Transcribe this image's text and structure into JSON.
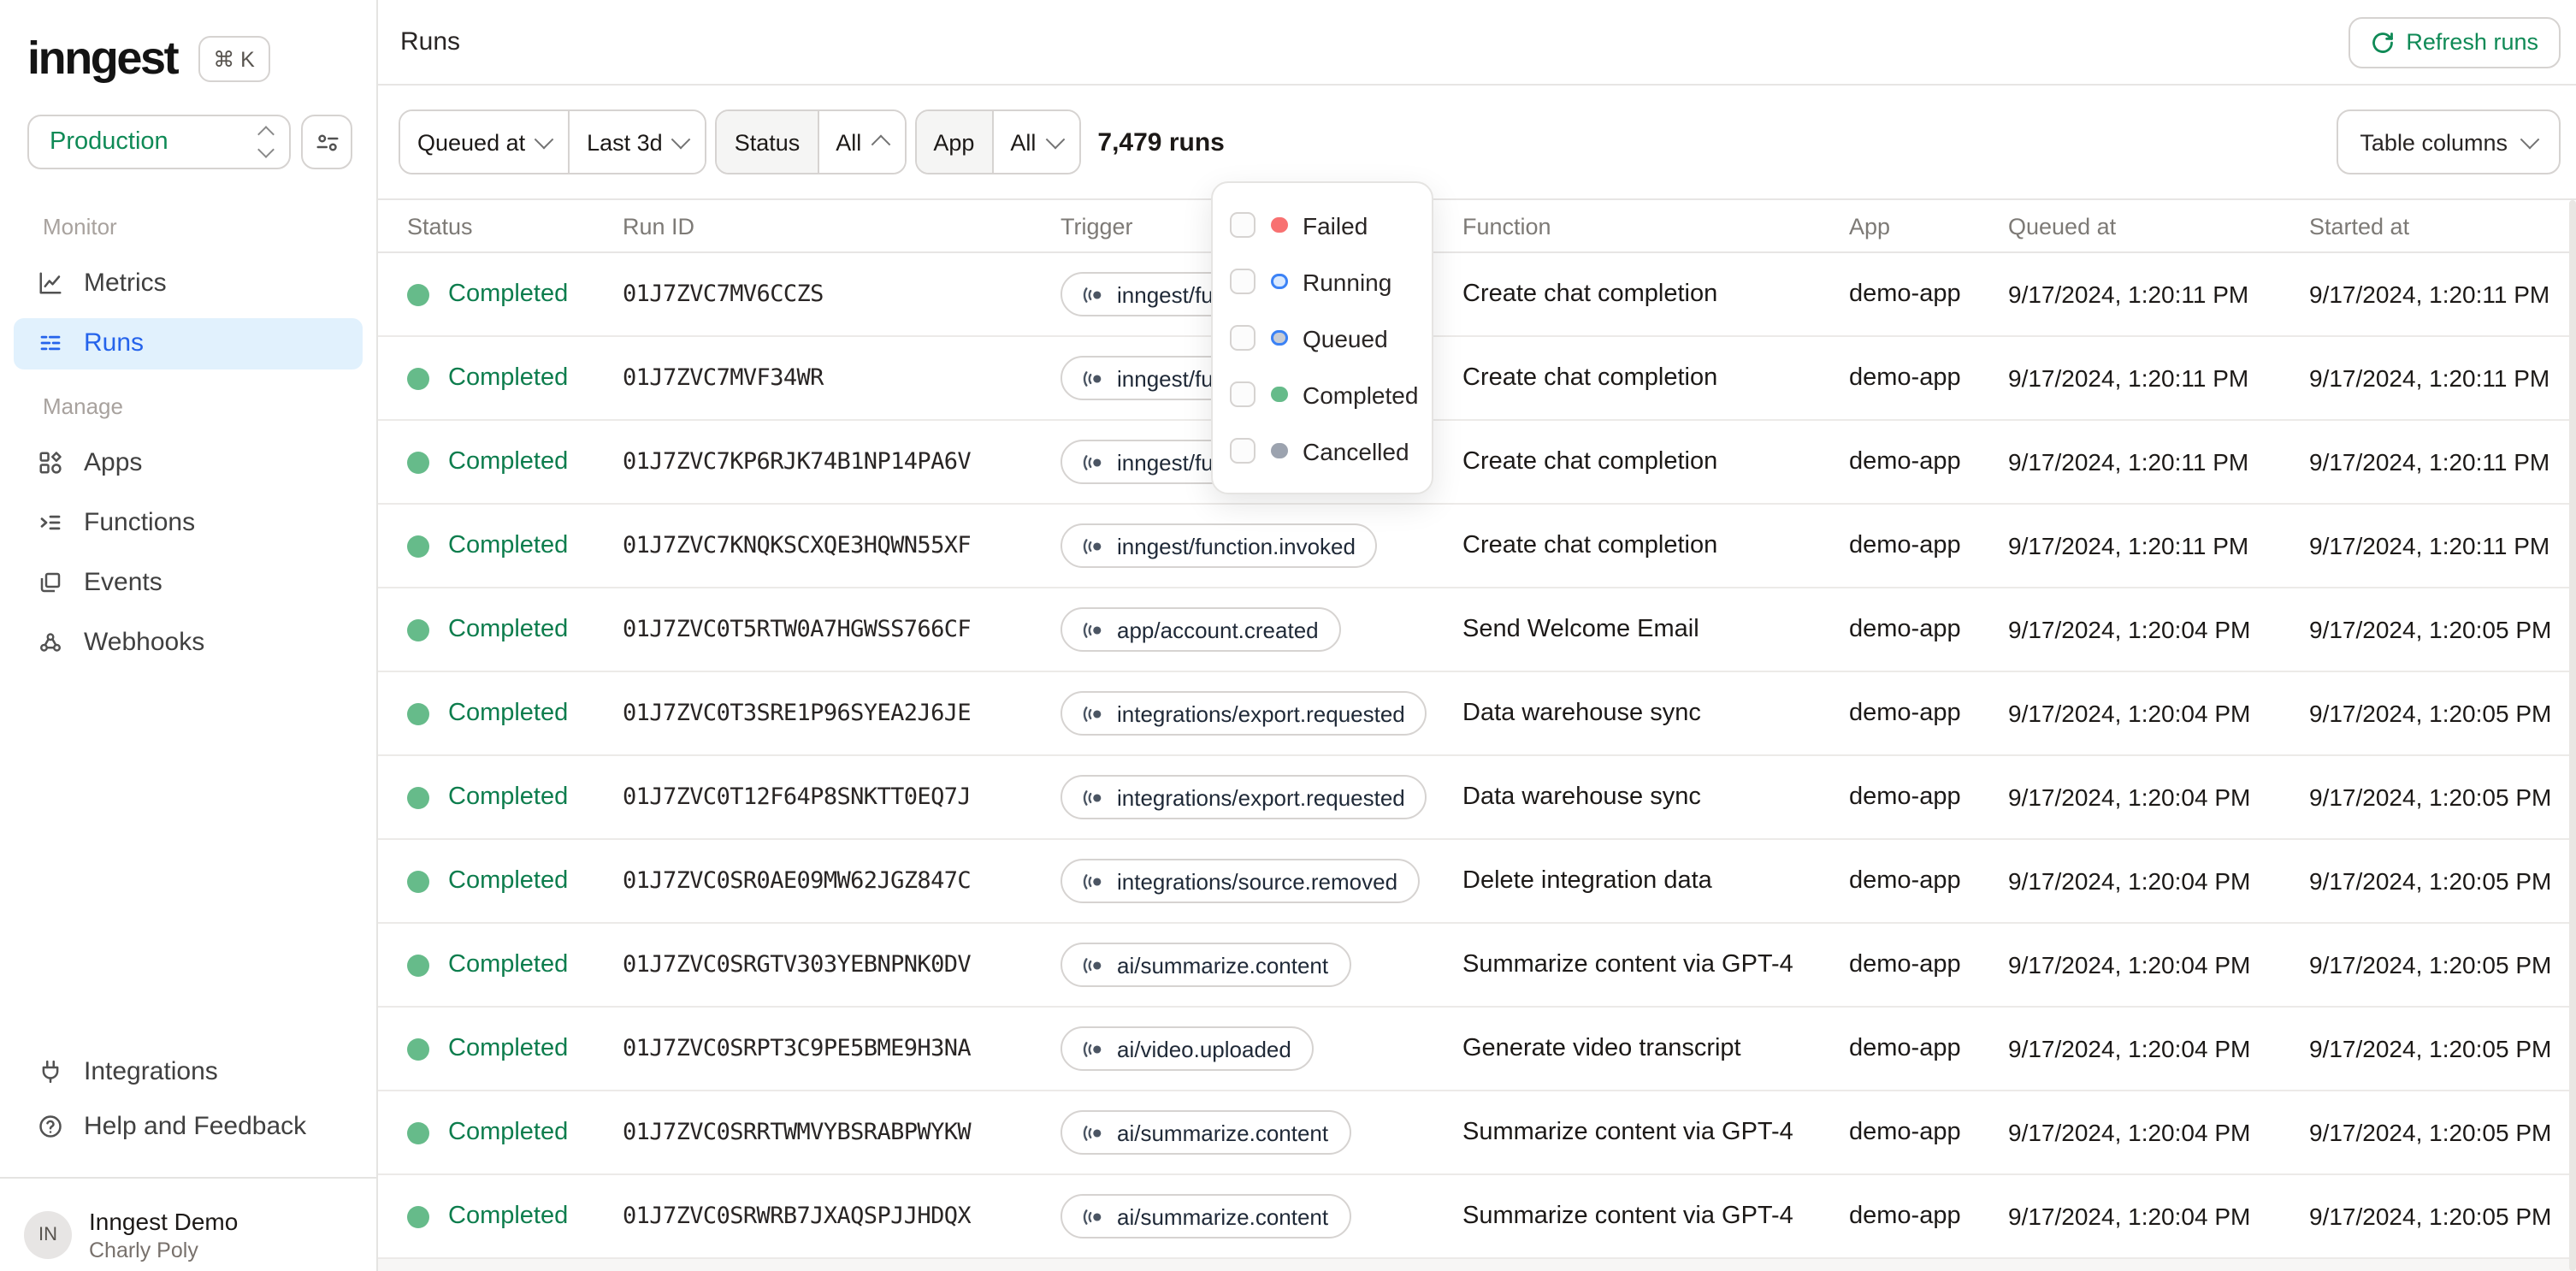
{
  "sidebar": {
    "logo": "inngest",
    "kbd_shortcut": "⌘ K",
    "environment": "Production",
    "sections": [
      {
        "label": "Monitor",
        "items": [
          {
            "label": "Metrics"
          },
          {
            "label": "Runs"
          }
        ]
      },
      {
        "label": "Manage",
        "items": [
          {
            "label": "Apps"
          },
          {
            "label": "Functions"
          },
          {
            "label": "Events"
          },
          {
            "label": "Webhooks"
          }
        ]
      }
    ],
    "footer_items": [
      {
        "label": "Integrations"
      },
      {
        "label": "Help and Feedback"
      }
    ],
    "user": {
      "initials": "IN",
      "org": "Inngest Demo",
      "name": "Charly Poly"
    }
  },
  "topbar": {
    "title": "Runs",
    "refresh_label": "Refresh runs"
  },
  "filters": {
    "queued_at_label": "Queued at",
    "time_range": "Last 3d",
    "status_label": "Status",
    "status_value": "All",
    "app_label": "App",
    "app_value": "All",
    "runs_count": "7,479 runs",
    "table_columns_label": "Table columns"
  },
  "status_dropdown": {
    "options": [
      {
        "label": "Failed",
        "fill": "#f87171",
        "ring": "#f87171"
      },
      {
        "label": "Running",
        "fill": "#dbeafe",
        "ring": "#3b82f6"
      },
      {
        "label": "Queued",
        "fill": "#c9cdd4",
        "ring": "#3b82f6"
      },
      {
        "label": "Completed",
        "fill": "#66bb8a",
        "ring": "#66bb8a"
      },
      {
        "label": "Cancelled",
        "fill": "#9ca3af",
        "ring": "#9ca3af"
      }
    ]
  },
  "table": {
    "columns": [
      "Status",
      "Run ID",
      "Trigger",
      "Function",
      "App",
      "Queued at",
      "Started at"
    ],
    "status_dot_color": "#66bb8a",
    "status_text_color": "#0d7d4d",
    "rows": [
      {
        "status": "Completed",
        "run_id": "01J7ZVC7MV6CCZS",
        "trigger": "inngest/function.invoked",
        "function": "Create chat completion",
        "app": "demo-app",
        "queued_at": "9/17/2024, 1:20:11 PM",
        "started_at": "9/17/2024, 1:20:11 PM"
      },
      {
        "status": "Completed",
        "run_id": "01J7ZVC7MVF34WR",
        "trigger": "inngest/function.invoked",
        "function": "Create chat completion",
        "app": "demo-app",
        "queued_at": "9/17/2024, 1:20:11 PM",
        "started_at": "9/17/2024, 1:20:11 PM"
      },
      {
        "status": "Completed",
        "run_id": "01J7ZVC7KP6RJK74B1NP14PA6V",
        "trigger": "inngest/function.invoked",
        "function": "Create chat completion",
        "app": "demo-app",
        "queued_at": "9/17/2024, 1:20:11 PM",
        "started_at": "9/17/2024, 1:20:11 PM"
      },
      {
        "status": "Completed",
        "run_id": "01J7ZVC7KNQKSCXQE3HQWN55XF",
        "trigger": "inngest/function.invoked",
        "function": "Create chat completion",
        "app": "demo-app",
        "queued_at": "9/17/2024, 1:20:11 PM",
        "started_at": "9/17/2024, 1:20:11 PM"
      },
      {
        "status": "Completed",
        "run_id": "01J7ZVC0T5RTW0A7HGWSS766CF",
        "trigger": "app/account.created",
        "function": "Send Welcome Email",
        "app": "demo-app",
        "queued_at": "9/17/2024, 1:20:04 PM",
        "started_at": "9/17/2024, 1:20:05 PM"
      },
      {
        "status": "Completed",
        "run_id": "01J7ZVC0T3SRE1P96SYEA2J6JE",
        "trigger": "integrations/export.requested",
        "function": "Data warehouse sync",
        "app": "demo-app",
        "queued_at": "9/17/2024, 1:20:04 PM",
        "started_at": "9/17/2024, 1:20:05 PM"
      },
      {
        "status": "Completed",
        "run_id": "01J7ZVC0T12F64P8SNKTT0EQ7J",
        "trigger": "integrations/export.requested",
        "function": "Data warehouse sync",
        "app": "demo-app",
        "queued_at": "9/17/2024, 1:20:04 PM",
        "started_at": "9/17/2024, 1:20:05 PM"
      },
      {
        "status": "Completed",
        "run_id": "01J7ZVC0SR0AE09MW62JGZ847C",
        "trigger": "integrations/source.removed",
        "function": "Delete integration data",
        "app": "demo-app",
        "queued_at": "9/17/2024, 1:20:04 PM",
        "started_at": "9/17/2024, 1:20:05 PM"
      },
      {
        "status": "Completed",
        "run_id": "01J7ZVC0SRGTV303YEBNPNK0DV",
        "trigger": "ai/summarize.content",
        "function": "Summarize content via GPT-4",
        "app": "demo-app",
        "queued_at": "9/17/2024, 1:20:04 PM",
        "started_at": "9/17/2024, 1:20:05 PM"
      },
      {
        "status": "Completed",
        "run_id": "01J7ZVC0SRPT3C9PE5BME9H3NA",
        "trigger": "ai/video.uploaded",
        "function": "Generate video transcript",
        "app": "demo-app",
        "queued_at": "9/17/2024, 1:20:04 PM",
        "started_at": "9/17/2024, 1:20:05 PM"
      },
      {
        "status": "Completed",
        "run_id": "01J7ZVC0SRRTWMVYBSRABPWYKW",
        "trigger": "ai/summarize.content",
        "function": "Summarize content via GPT-4",
        "app": "demo-app",
        "queued_at": "9/17/2024, 1:20:04 PM",
        "started_at": "9/17/2024, 1:20:05 PM"
      },
      {
        "status": "Completed",
        "run_id": "01J7ZVC0SRWRB7JXAQSPJJHDQX",
        "trigger": "ai/summarize.content",
        "function": "Summarize content via GPT-4",
        "app": "demo-app",
        "queued_at": "9/17/2024, 1:20:04 PM",
        "started_at": "9/17/2024, 1:20:05 PM"
      }
    ]
  }
}
